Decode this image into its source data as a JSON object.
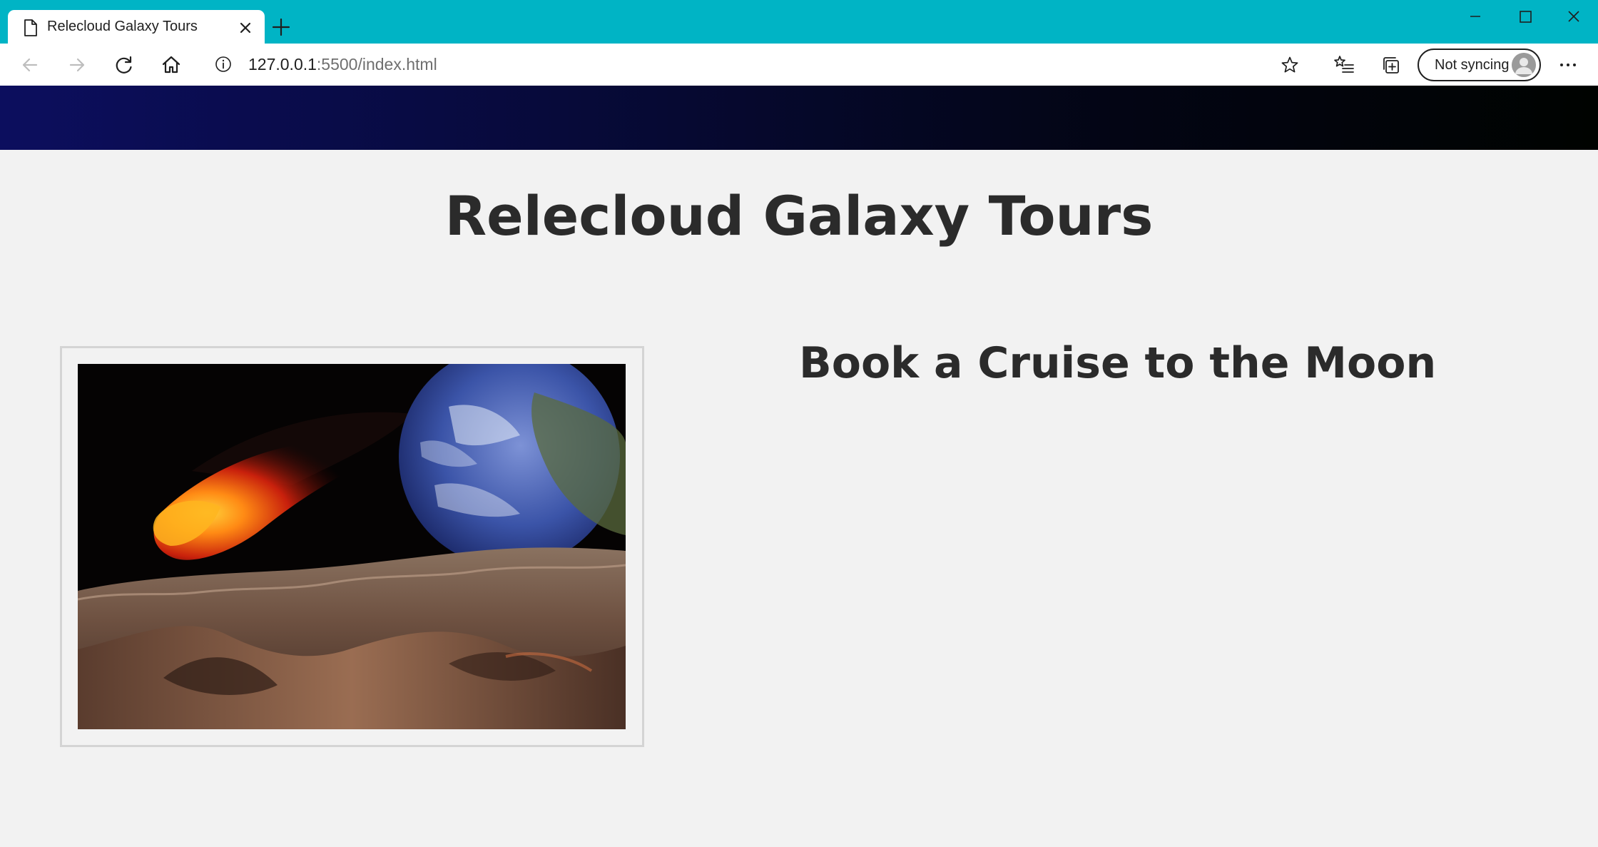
{
  "browser": {
    "tab": {
      "title": "Relecloud Galaxy Tours",
      "icon": "document-icon"
    },
    "address_bar": {
      "host": "127.0.0.1",
      "path": ":5500/index.html"
    },
    "profile": {
      "label": "Not syncing"
    },
    "colors": {
      "titlebar": "#00b4c5",
      "toolbar": "#ffffff"
    }
  },
  "page": {
    "title": "Relecloud Galaxy Tours",
    "hero_heading": "Book a Cruise to the Moon",
    "hero_image": {
      "subject": "moon-surface-earth-meteor"
    },
    "colors": {
      "background": "#f2f2f2",
      "text": "#2b2b2b",
      "header_start": "#0c0e5e",
      "header_end": "#000300"
    }
  }
}
